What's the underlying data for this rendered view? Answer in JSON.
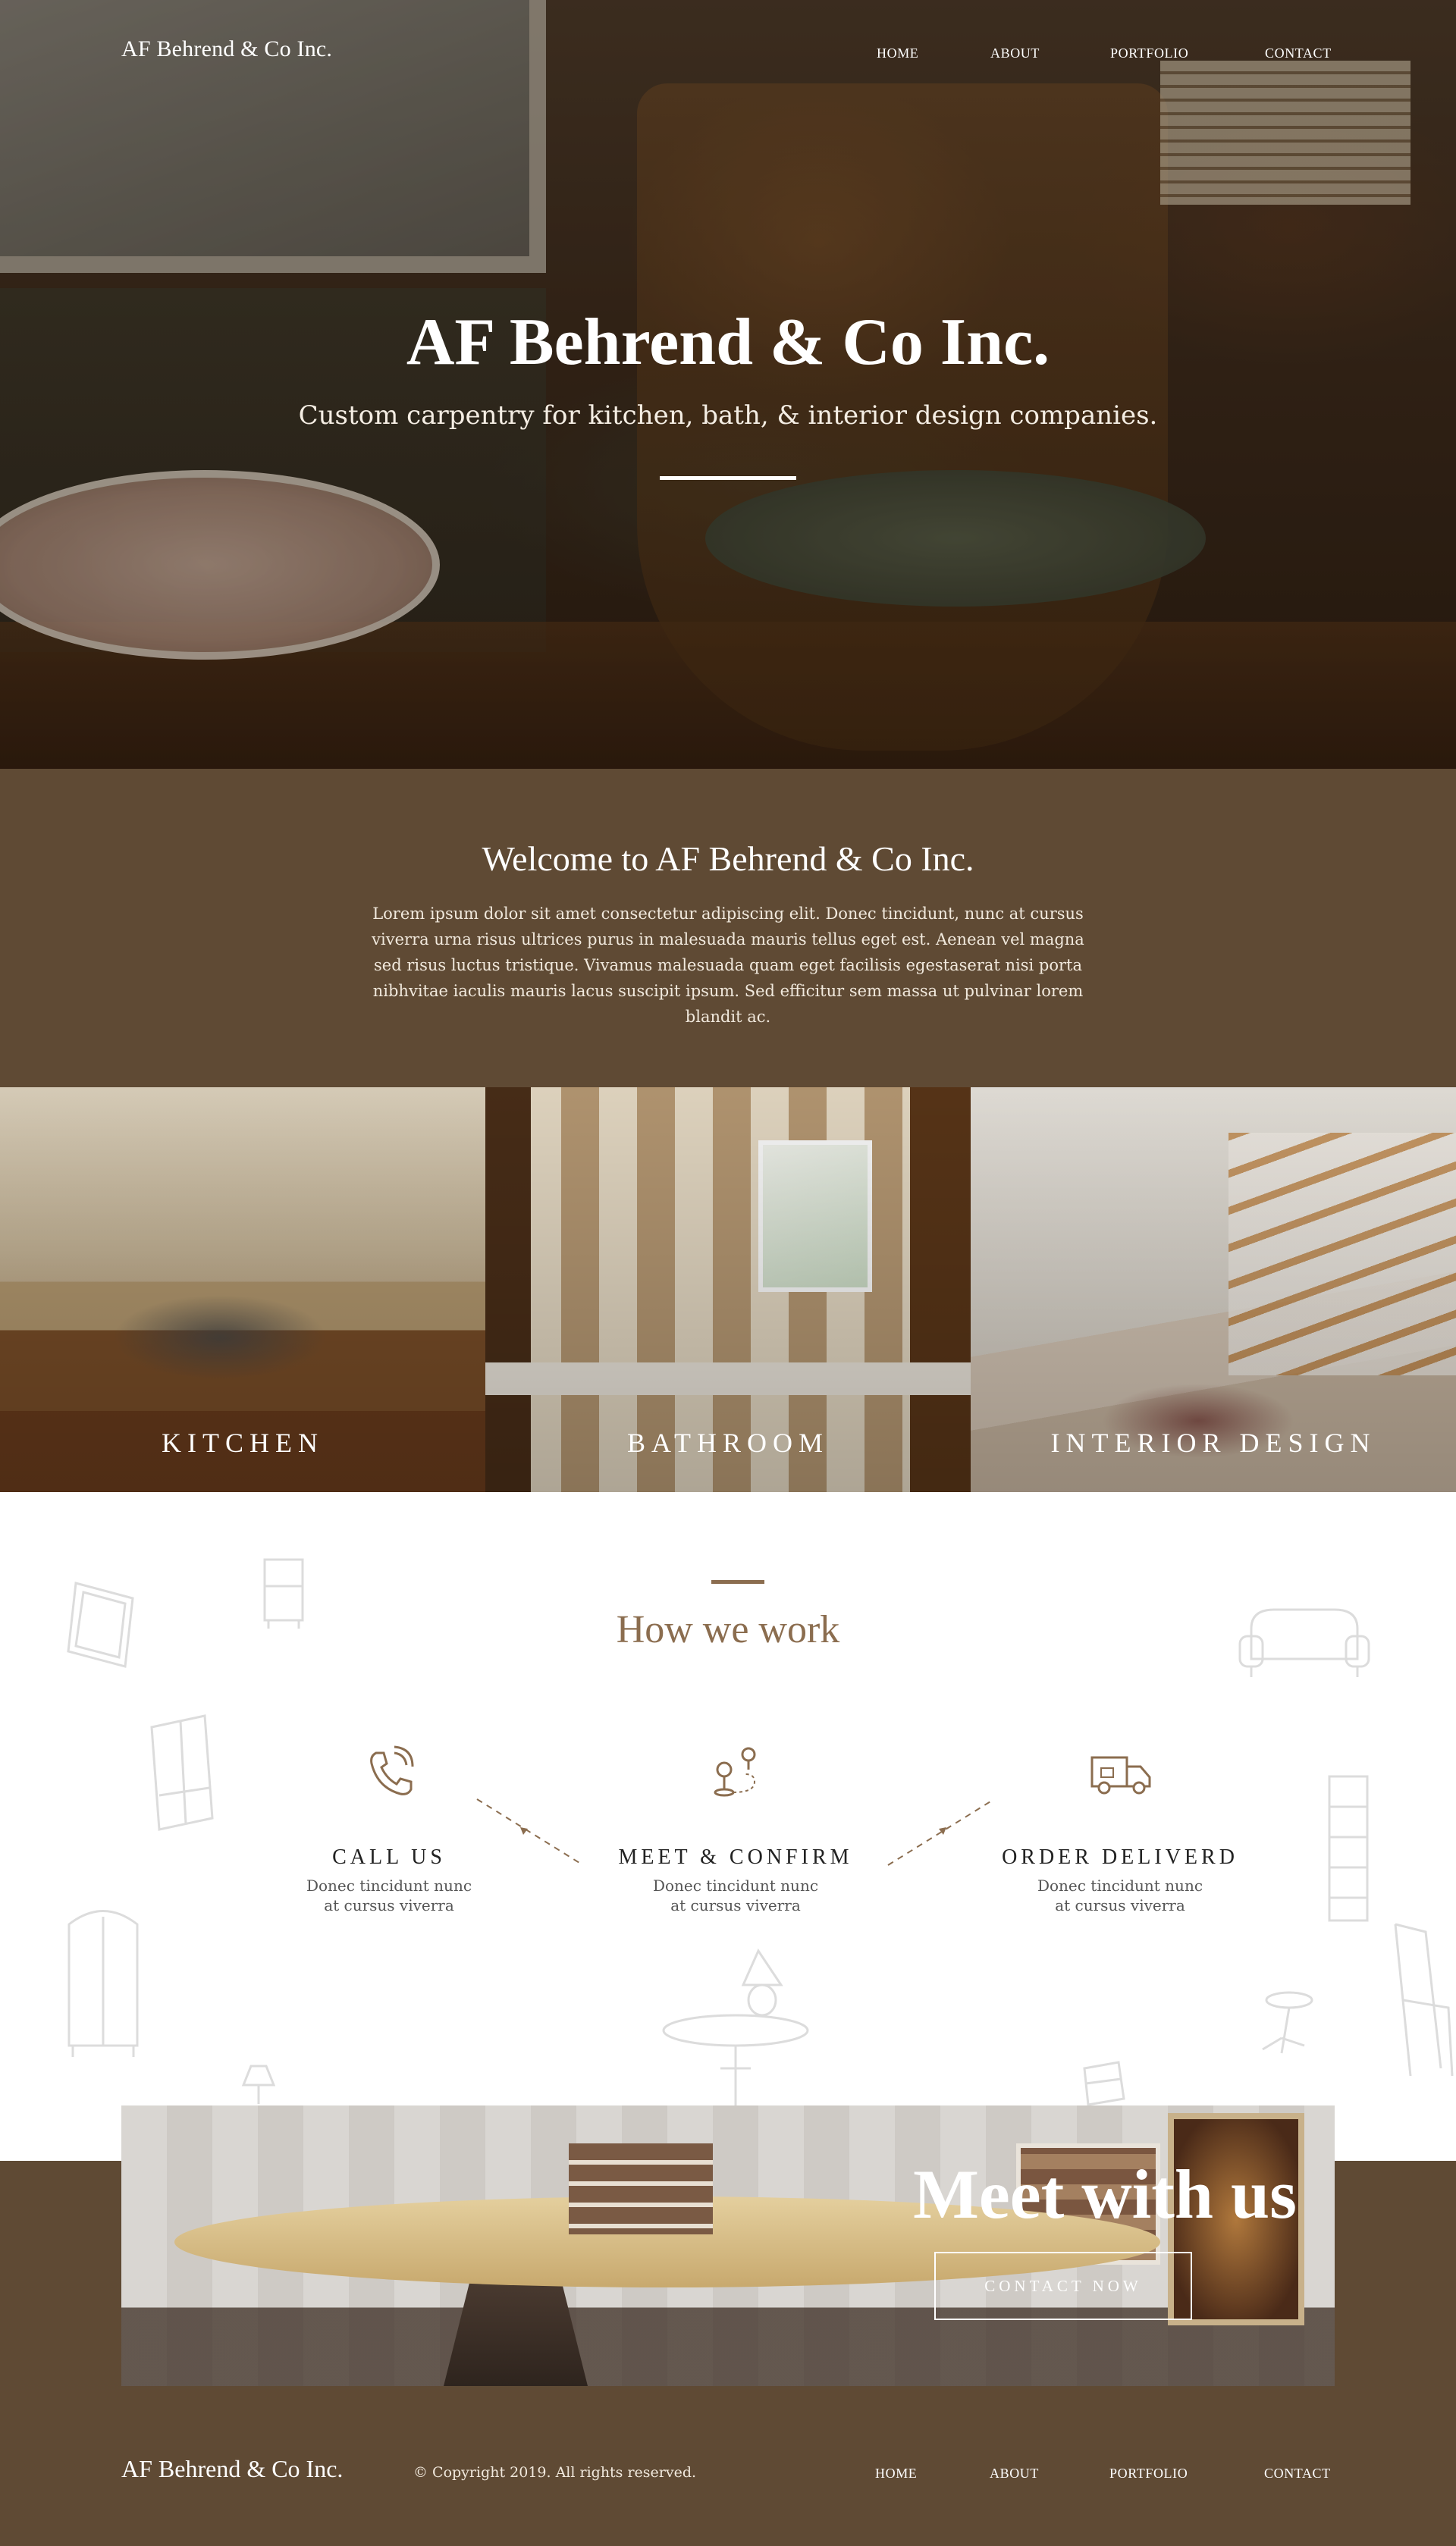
{
  "brand": "AF Behrend & Co Inc.",
  "nav": [
    "HOME",
    "ABOUT",
    "PORTFOLIO",
    "CONTACT"
  ],
  "hero": {
    "title": "AF Behrend & Co Inc.",
    "subtitle": "Custom carpentry for kitchen, bath, & interior design companies."
  },
  "welcome": {
    "title": "Welcome to AF Behrend & Co Inc.",
    "body": "Lorem ipsum dolor sit amet consectetur adipiscing elit. Donec tincidunt, nunc at cursus viverra urna risus ultrices purus in malesuada mauris tellus eget est. Aenean vel magna sed risus luctus tristique. Vivamus malesuada quam eget facilisis egestaserat nisi porta nibhvitae iaculis mauris lacus suscipit ipsum. Sed efficitur sem massa ut pulvinar lorem blandit ac."
  },
  "categories": [
    "KITCHEN",
    "BATHROOM",
    "INTERIOR DESIGN"
  ],
  "how": {
    "title": "How we work",
    "steps": [
      {
        "title": "CALL US",
        "line1": "Donec tincidunt nunc",
        "line2": "at cursus viverra",
        "icon": "phone-icon"
      },
      {
        "title": "MEET & CONFIRM",
        "line1": "Donec tincidunt nunc",
        "line2": "at cursus viverra",
        "icon": "location-pin-icon"
      },
      {
        "title": "ORDER DELIVERD",
        "line1": "Donec tincidunt nunc",
        "line2": "at cursus viverra",
        "icon": "delivery-truck-icon"
      }
    ]
  },
  "meet": {
    "title": "Meet with us",
    "button": "CONTACT NOW"
  },
  "footer": {
    "brand": "AF Behrend & Co Inc.",
    "copyright": "© Copyright 2019. All rights reserved.",
    "nav": [
      "HOME",
      "ABOUT",
      "PORTFOLIO",
      "CONTACT"
    ]
  },
  "colors": {
    "brown": "#5f4a34",
    "accent": "#8b6d4f",
    "white": "#ffffff"
  }
}
